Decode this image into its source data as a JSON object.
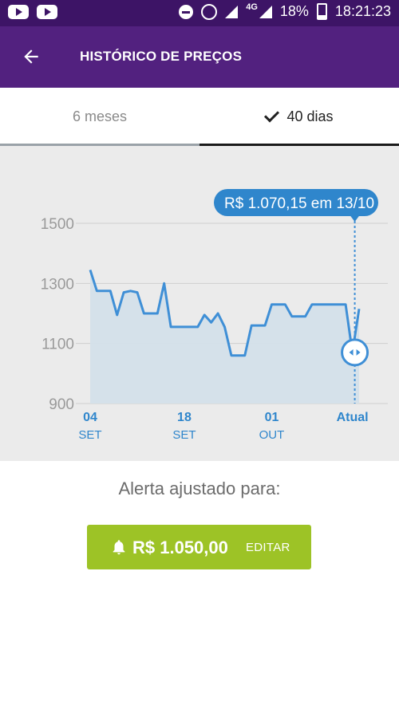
{
  "status_bar": {
    "network": "4G",
    "battery": "18%",
    "time": "18:21:23"
  },
  "header": {
    "title": "HISTÓRICO DE PREÇOS"
  },
  "tabs": [
    {
      "label": "6 meses",
      "selected": false
    },
    {
      "label": "40 dias",
      "selected": true
    }
  ],
  "chart_data": {
    "type": "area",
    "yticks": [
      "1500",
      "1300",
      "1100",
      "900"
    ],
    "ytick_values": [
      1500,
      1300,
      1100,
      900
    ],
    "ylim": [
      880,
      1560
    ],
    "xticks": [
      {
        "day": "04",
        "month": "SET",
        "index": 0
      },
      {
        "day": "18",
        "month": "SET",
        "index": 14
      },
      {
        "day": "01",
        "month": "OUT",
        "index": 27
      },
      {
        "day": "Atual",
        "month": "",
        "index": 39
      }
    ],
    "series": [
      {
        "values": [
          1345,
          1275,
          1275,
          1275,
          1195,
          1270,
          1275,
          1270,
          1200,
          1200,
          1200,
          1300,
          1155,
          1155,
          1155,
          1155,
          1155,
          1195,
          1170,
          1200,
          1155,
          1060,
          1060,
          1060,
          1160,
          1160,
          1160,
          1230,
          1230,
          1230,
          1190,
          1190,
          1190,
          1230,
          1230,
          1230,
          1230,
          1230,
          1230,
          1070,
          1215
        ],
        "color": "#3f8fd6"
      }
    ],
    "tooltip": "R$ 1.070,15 em 13/10",
    "marker_index": 39,
    "marker_value": 1070.15,
    "grid": true
  },
  "alert": {
    "label": "Alerta ajustado para:",
    "value": "R$ 1.050,00",
    "edit_label": "EDITAR",
    "color": "#9dc326"
  },
  "colors": {
    "status_bar": "#3d1466",
    "app_bar": "#52217f",
    "line": "#3f8fd6",
    "fill": "#d3e0ea"
  }
}
